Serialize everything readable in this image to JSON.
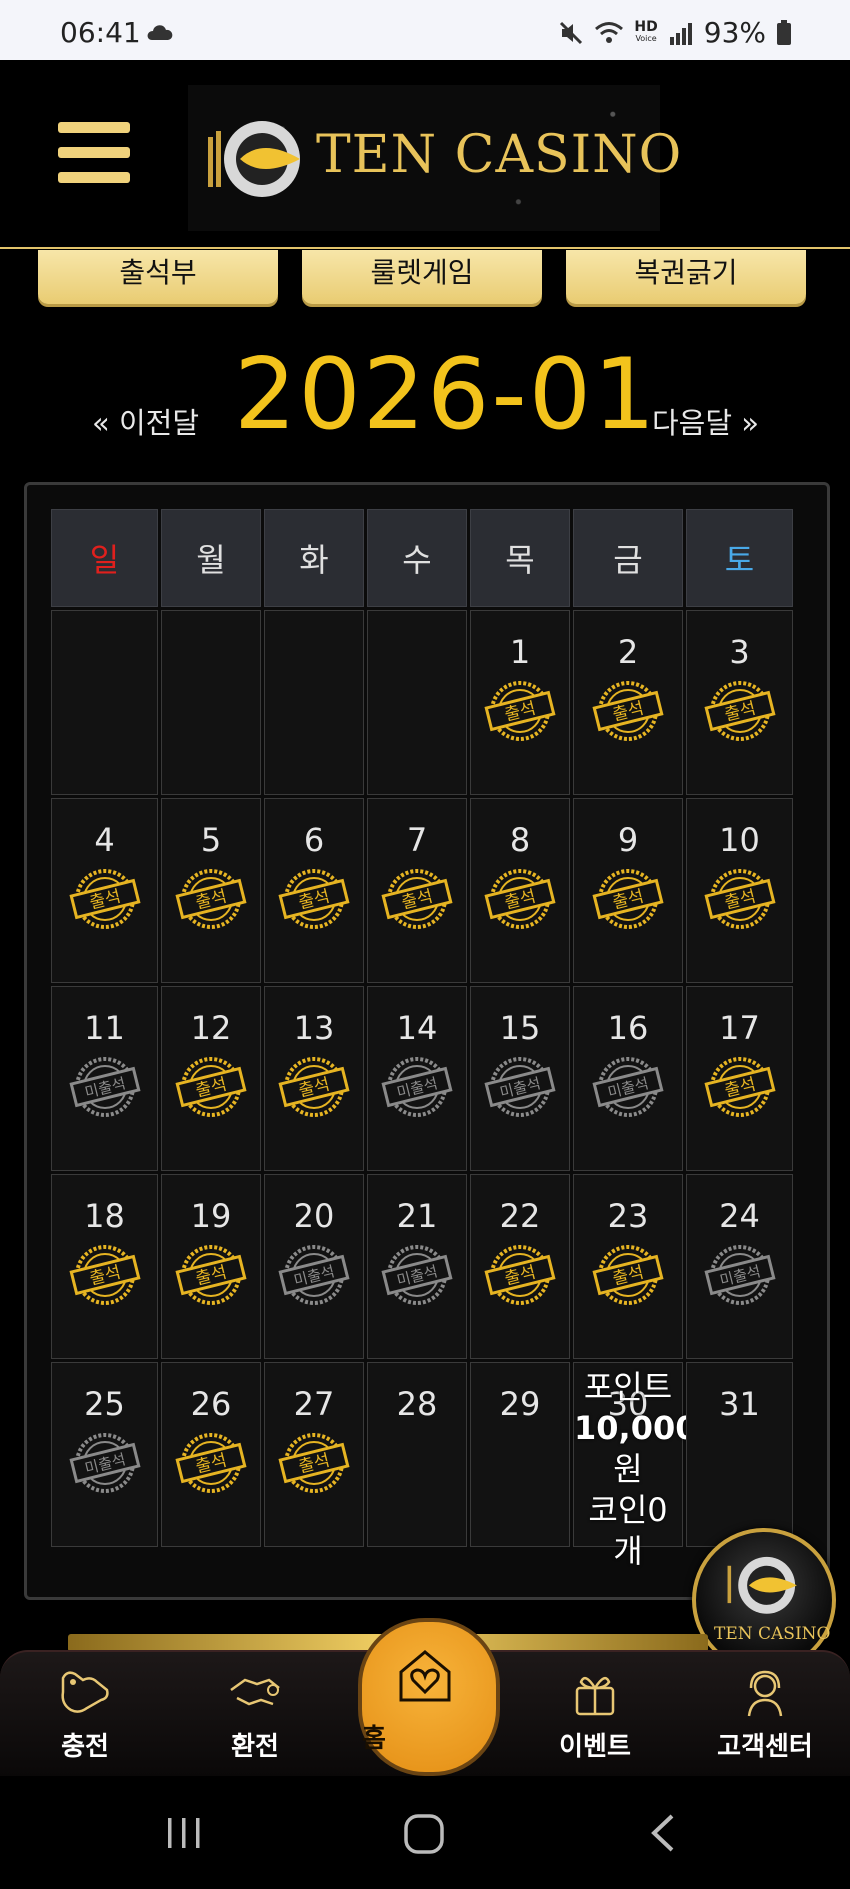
{
  "status_bar": {
    "time": "06:41",
    "hd_label": "HD",
    "voice_label": "Voice",
    "battery": "93%"
  },
  "header": {
    "logo_text": "TEN CASINO"
  },
  "tabs": [
    {
      "label": "출석부"
    },
    {
      "label": "룰렛게임"
    },
    {
      "label": "복권긁기"
    }
  ],
  "calendar": {
    "month": "2026-01",
    "prev_label": "« 이전달",
    "next_label": "다음달 »",
    "weekdays": [
      "일",
      "월",
      "화",
      "수",
      "목",
      "금",
      "토"
    ],
    "stamp_attended": "출석",
    "stamp_absent": "미출석",
    "weeks": [
      [
        {
          "day": "",
          "s": ""
        },
        {
          "day": "",
          "s": ""
        },
        {
          "day": "",
          "s": ""
        },
        {
          "day": "",
          "s": ""
        },
        {
          "day": "1",
          "s": "a"
        },
        {
          "day": "2",
          "s": "a"
        },
        {
          "day": "3",
          "s": "a"
        }
      ],
      [
        {
          "day": "4",
          "s": "a"
        },
        {
          "day": "5",
          "s": "a"
        },
        {
          "day": "6",
          "s": "a"
        },
        {
          "day": "7",
          "s": "a"
        },
        {
          "day": "8",
          "s": "a"
        },
        {
          "day": "9",
          "s": "a"
        },
        {
          "day": "10",
          "s": "a"
        }
      ],
      [
        {
          "day": "11",
          "s": "m"
        },
        {
          "day": "12",
          "s": "a"
        },
        {
          "day": "13",
          "s": "a"
        },
        {
          "day": "14",
          "s": "m"
        },
        {
          "day": "15",
          "s": "m"
        },
        {
          "day": "16",
          "s": "m"
        },
        {
          "day": "17",
          "s": "a"
        }
      ],
      [
        {
          "day": "18",
          "s": "a"
        },
        {
          "day": "19",
          "s": "a"
        },
        {
          "day": "20",
          "s": "m"
        },
        {
          "day": "21",
          "s": "m"
        },
        {
          "day": "22",
          "s": "a"
        },
        {
          "day": "23",
          "s": "a"
        },
        {
          "day": "24",
          "s": "m"
        }
      ],
      [
        {
          "day": "25",
          "s": "m"
        },
        {
          "day": "26",
          "s": "a"
        },
        {
          "day": "27",
          "s": "a"
        },
        {
          "day": "28",
          "s": ""
        },
        {
          "day": "29",
          "s": ""
        },
        {
          "day": "30",
          "s": ""
        },
        {
          "day": "31",
          "s": ""
        }
      ]
    ],
    "reward_tooltip": {
      "line1": "포인트",
      "line2": "10,000",
      "line3": "원",
      "line4": "코인0",
      "line5": "개"
    }
  },
  "floating_logo": {
    "text": "TEN CASINO"
  },
  "bottom_nav": {
    "charge": "충전",
    "exchange": "환전",
    "home": "홈",
    "event": "이벤트",
    "support": "고객센터"
  },
  "colors": {
    "gold": "#f3c31c",
    "stamp_gold": "#e6b422",
    "stamp_gray": "#8a8a8a",
    "sunday": "#e0201d",
    "saturday": "#49a9e8"
  }
}
